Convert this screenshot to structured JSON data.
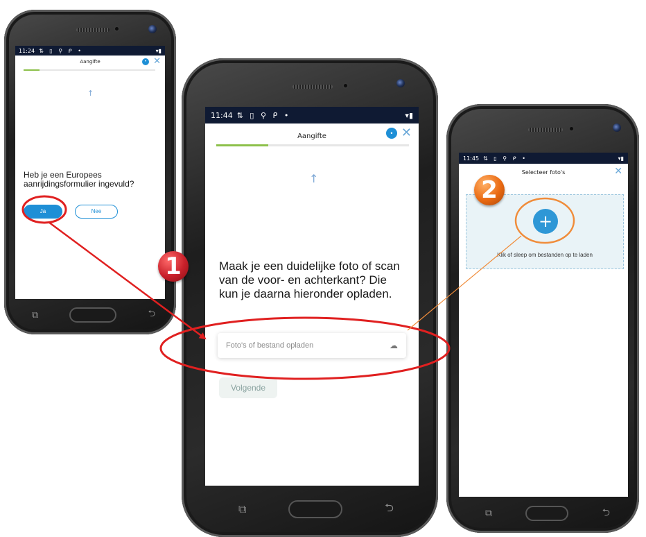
{
  "screen1": {
    "status": {
      "time": "11:24",
      "icons": "⇅ ▯ ⚲ ᑭ •",
      "right_icons": "▾▮"
    },
    "header": {
      "title": "Aangifte"
    },
    "progress": 0.12,
    "arrow": "↑",
    "question": "Heb je een Europees aanrijdingsformulier ingevuld?",
    "buttons": {
      "yes": "Ja",
      "no": "Nee"
    }
  },
  "screen2": {
    "status": {
      "time": "11:44",
      "icons": "⇅ ▯ ⚲ ᑭ •",
      "right_icons": "▾▮"
    },
    "header": {
      "title": "Aangifte"
    },
    "progress": 0.27,
    "arrow": "↑",
    "instruction": "Maak je een duidelijke foto of scan van de voor- en achterkant? Die kun je daarna hieronder opladen.",
    "upload": {
      "placeholder": "Foto's of bestand opladen",
      "icon": "cloud-upload-icon"
    },
    "next_button": "Volgende"
  },
  "screen3": {
    "status": {
      "time": "11:45",
      "icons": "⇅ ▯ ⚲ ᑭ •",
      "right_icons": "▾▮"
    },
    "header": {
      "title": "Selecteer foto's"
    },
    "dropzone": {
      "plus": "+",
      "text": "Klik of sleep om bestanden op te laden"
    }
  },
  "annotations": {
    "badge1": "1",
    "badge2": "2",
    "colors": {
      "red": "#e02020",
      "orange": "#f08c3a",
      "badge_red": "#c8202a",
      "badge_orange": "#ea6a12"
    }
  },
  "nav": {
    "recents": "⧉",
    "back": "⮌"
  }
}
